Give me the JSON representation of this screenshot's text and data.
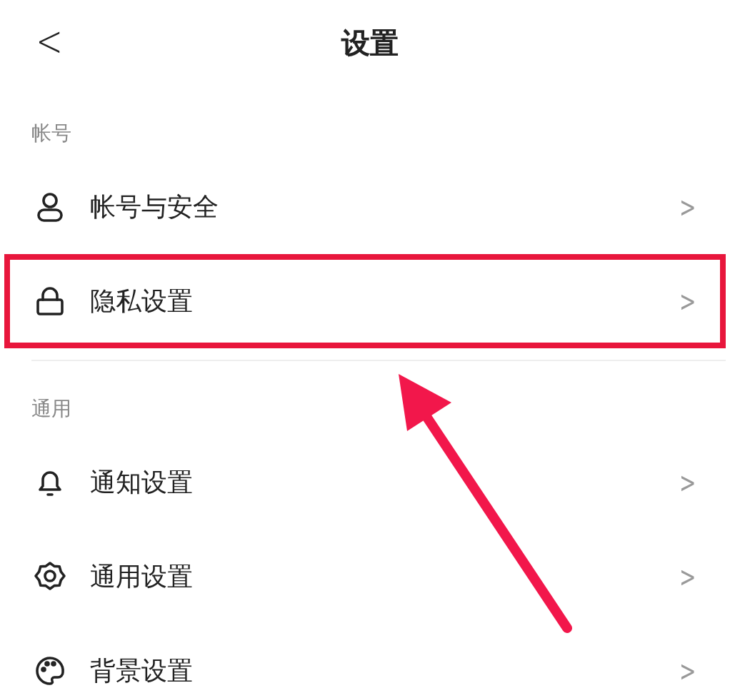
{
  "header": {
    "back": "<",
    "title": "设置"
  },
  "sections": [
    {
      "title": "帐号",
      "items": [
        {
          "label": "帐号与安全",
          "chevron": ">",
          "highlighted": false
        },
        {
          "label": "隐私设置",
          "chevron": ">",
          "highlighted": true
        }
      ]
    },
    {
      "title": "通用",
      "items": [
        {
          "label": "通知设置",
          "chevron": ">",
          "highlighted": false
        },
        {
          "label": "通用设置",
          "chevron": ">",
          "highlighted": false
        },
        {
          "label": "背景设置",
          "chevron": ">",
          "highlighted": false
        }
      ]
    }
  ],
  "annotations": [
    {
      "kind": "arrow"
    }
  ]
}
